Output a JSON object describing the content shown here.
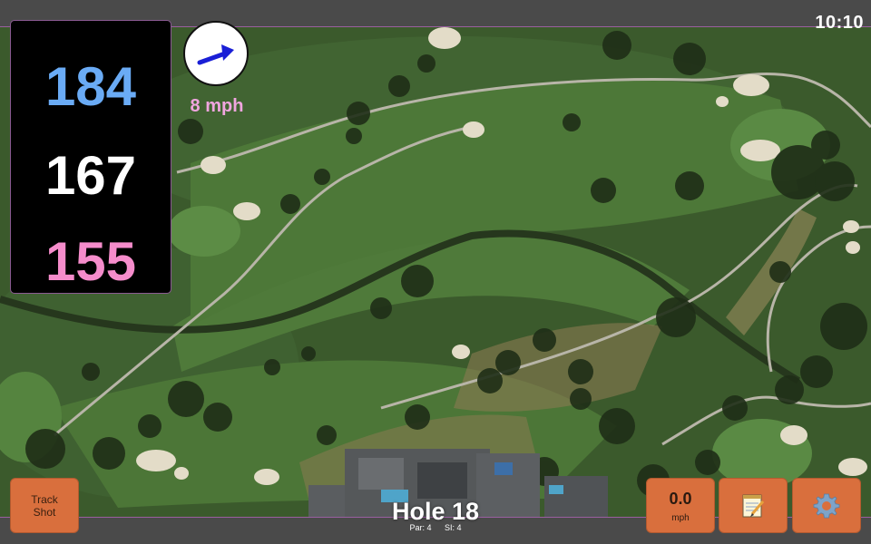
{
  "status": {
    "time": "10:10"
  },
  "distances": {
    "back": "184",
    "middle": "167",
    "front": "155"
  },
  "wind": {
    "speed": "8 mph",
    "icon": "wind-arrow-icon",
    "direction": "up-right"
  },
  "buttons": {
    "track_shot_line1": "Track",
    "track_shot_line2": "Shot",
    "speed_value": "0.0",
    "speed_unit": "mph",
    "notes_icon": "notepad-icon",
    "settings_icon": "gear-icon"
  },
  "hole": {
    "title": "Hole 18",
    "par": "Par: 4",
    "si": "SI: 4"
  },
  "colors": {
    "back_distance": "#6aabf5",
    "middle_distance": "#ffffff",
    "front_distance": "#f58ccb",
    "wind_speed_text": "#f0a5df",
    "button_bg": "#d96f3d",
    "fairway": "#4f7a3a"
  }
}
